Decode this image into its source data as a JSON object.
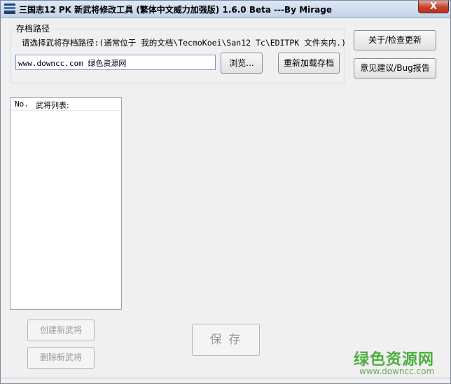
{
  "window": {
    "title": "三国志12 PK 新武将修改工具 (繁体中文威力加强版) 1.6.0 Beta ---By Mirage",
    "close_glyph": "X"
  },
  "save_path": {
    "group_label": "存档路径",
    "hint": "请选择武将存档路径:(通常位于 我的文档\\TecmoKoei\\San12 Tc\\EDITPK 文件夹内.)",
    "input_value": "www.downcc.com 绿色资源网",
    "browse_label": "浏览...",
    "reload_label": "重新加载存档"
  },
  "side_buttons": {
    "about_label": "关于/检查更新",
    "feedback_label": "意见建议/Bug报告"
  },
  "general_list": {
    "col_no": "No.",
    "col_name": "武将列表:"
  },
  "actions": {
    "create_label": "创建新武将",
    "delete_label": "删除新武将",
    "save_label": "保  存"
  },
  "watermark": {
    "main": "绿色资源网",
    "sub": "www.downcc.com"
  }
}
